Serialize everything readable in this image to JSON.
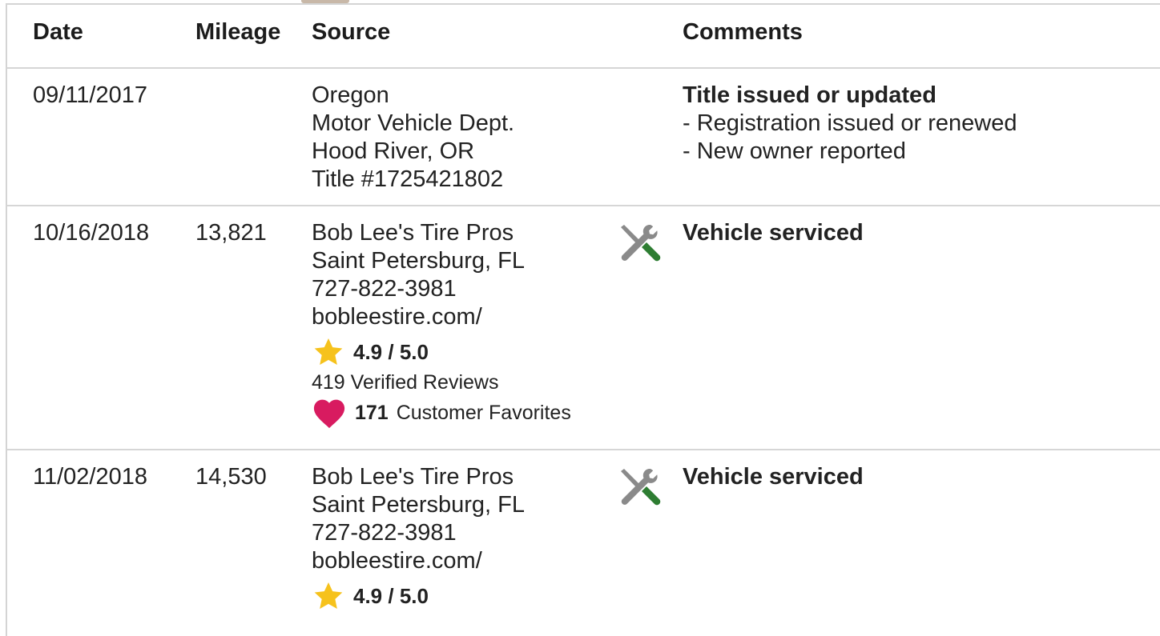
{
  "headers": {
    "date": "Date",
    "mileage": "Mileage",
    "source": "Source",
    "comments": "Comments"
  },
  "records": [
    {
      "date": "09/11/2017",
      "mileage": "",
      "source": [
        "Oregon",
        "Motor Vehicle Dept.",
        "Hood River, OR",
        "Title #1725421802"
      ],
      "comment_title": "Title issued or updated",
      "comment_items": [
        "- Registration issued or renewed",
        "- New owner reported"
      ]
    },
    {
      "date": "10/16/2018",
      "mileage": "13,821",
      "source": [
        "Bob Lee's Tire Pros",
        "Saint Petersburg, FL",
        "727-822-3981",
        "bobleestire.com/"
      ],
      "rating": "4.9 / 5.0",
      "reviews": "419 Verified Reviews",
      "favorites_count": "171",
      "favorites_label": "Customer Favorites",
      "comment_title": "Vehicle serviced",
      "service_icon": "wrench-screwdriver-icon"
    },
    {
      "date": "11/02/2018",
      "mileage": "14,530",
      "source": [
        "Bob Lee's Tire Pros",
        "Saint Petersburg, FL",
        "727-822-3981",
        "bobleestire.com/"
      ],
      "rating": "4.9 / 5.0",
      "comment_title": "Vehicle serviced",
      "service_icon": "wrench-screwdriver-icon"
    }
  ],
  "colors": {
    "star": "#f6c21c",
    "heart": "#d81b60",
    "tool_gray": "#8a8a8a",
    "tool_green": "#2e7d32",
    "divider": "#d6d6d6"
  }
}
